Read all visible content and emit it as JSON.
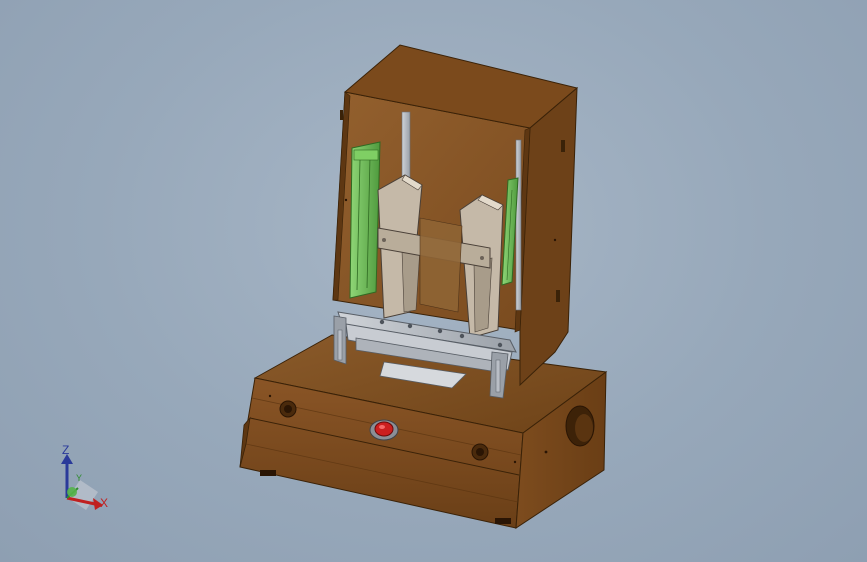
{
  "viewport": {
    "background_color": "#97a8ba"
  },
  "model": {
    "body_color": "#7a4a1e",
    "rail_color": "#6fbf5a",
    "button_color": "#cc1f1f",
    "steel_color": "#b9bec6"
  },
  "triad": {
    "z_label": "Z",
    "y_label": "Y",
    "x_label": "X"
  }
}
